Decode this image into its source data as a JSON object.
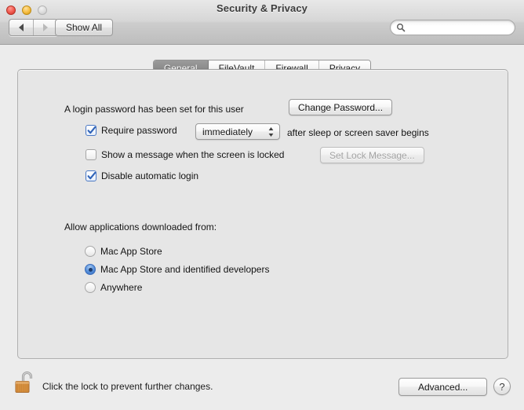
{
  "window": {
    "title": "Security & Privacy",
    "traffic_lights": {
      "close": "close-button",
      "minimize": "minimize-button",
      "zoom": "zoom-button"
    }
  },
  "toolbar": {
    "back_icon": "back-arrow-icon",
    "forward_icon": "forward-arrow-icon",
    "show_all_label": "Show All",
    "search": {
      "value": "",
      "placeholder": "",
      "icon": "search-icon"
    }
  },
  "tabs": [
    {
      "label": "General",
      "selected": true
    },
    {
      "label": "FileVault",
      "selected": false
    },
    {
      "label": "Firewall",
      "selected": false
    },
    {
      "label": "Privacy",
      "selected": false
    }
  ],
  "general": {
    "password_status": "A login password has been set for this user",
    "change_password_label": "Change Password...",
    "require_password": {
      "checked": true,
      "label": "Require password",
      "popup_value": "immediately",
      "popup_options": [
        "immediately"
      ],
      "suffix": "after sleep or screen saver begins"
    },
    "show_message": {
      "checked": false,
      "label": "Show a message when the screen is locked",
      "button_label": "Set Lock Message...",
      "button_disabled": true
    },
    "disable_auto_login": {
      "checked": true,
      "label": "Disable automatic login"
    },
    "allow_apps_heading": "Allow applications downloaded from:",
    "allow_apps_options": [
      {
        "label": "Mac App Store",
        "selected": false
      },
      {
        "label": "Mac App Store and identified developers",
        "selected": true
      },
      {
        "label": "Anywhere",
        "selected": false
      }
    ]
  },
  "footer": {
    "lock_icon": "unlocked-padlock-icon",
    "lock_text": "Click the lock to prevent further changes.",
    "advanced_label": "Advanced...",
    "help_label": "?"
  },
  "colors": {
    "accent_blue": "#3d6ebb",
    "selected_tab_bg": "#8c8c8c",
    "window_bg": "#ececec",
    "panel_bg": "#e6e6e6",
    "lock_body": "#d9913f"
  }
}
